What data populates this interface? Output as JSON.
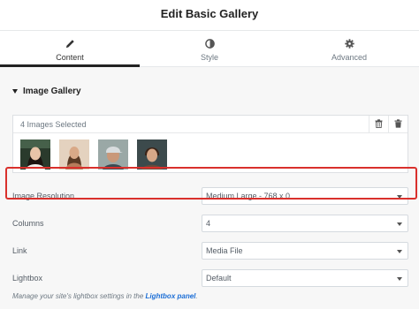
{
  "header": {
    "title": "Edit Basic Gallery"
  },
  "tabs": [
    {
      "label": "Content",
      "icon": "pencil-icon",
      "active": true
    },
    {
      "label": "Style",
      "icon": "contrast-icon",
      "active": false
    },
    {
      "label": "Advanced",
      "icon": "gear-icon",
      "active": false
    }
  ],
  "section": {
    "title": "Image Gallery"
  },
  "gallery": {
    "count_label": "4 Images Selected",
    "actions": [
      "trash-icon",
      "delete-all-icon"
    ],
    "thumbnails": [
      "woman-portrait-1",
      "woman-portrait-2",
      "man-portrait-cap",
      "man-portrait-2"
    ]
  },
  "fields": [
    {
      "label": "Image Resolution",
      "value": "Medium Large - 768 x 0"
    },
    {
      "label": "Columns",
      "value": "4"
    },
    {
      "label": "Link",
      "value": "Media File"
    },
    {
      "label": "Lightbox",
      "value": "Default"
    }
  ],
  "note": {
    "prefix": "Manage your site's lightbox settings in the ",
    "link": "Lightbox panel",
    "suffix": "."
  },
  "colors": {
    "highlight": "#d9302c",
    "link": "#1c6ed6",
    "active_tab": "#222222"
  }
}
